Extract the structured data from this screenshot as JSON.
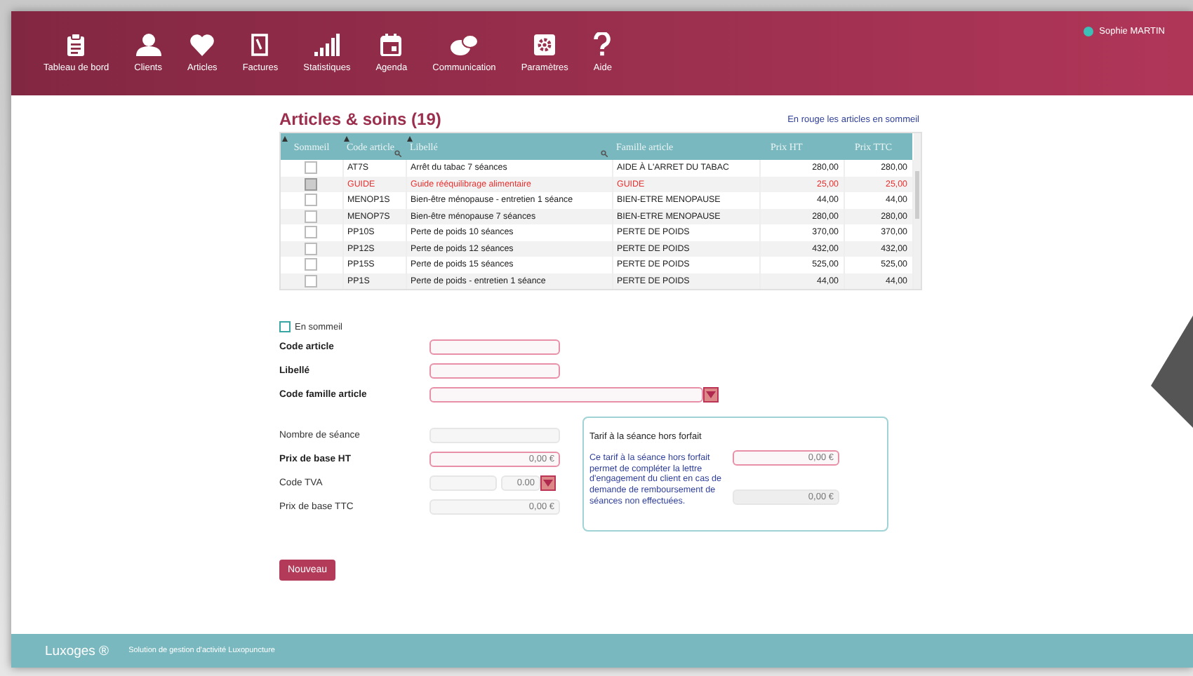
{
  "nav": {
    "items": [
      {
        "label": "Tableau de bord"
      },
      {
        "label": "Clients"
      },
      {
        "label": "Articles"
      },
      {
        "label": "Factures"
      },
      {
        "label": "Statistiques"
      },
      {
        "label": "Agenda"
      },
      {
        "label": "Communication"
      },
      {
        "label": "Paramètres"
      },
      {
        "label": "Aide"
      }
    ],
    "user": {
      "name": "Sophie MARTIN",
      "color": "#3bbfb7"
    }
  },
  "title": "Articles & soins (19)",
  "legend_link": "En rouge les articles en sommeil",
  "table": {
    "columns": [
      {
        "label": "Sommeil",
        "sortable": true,
        "filter": false
      },
      {
        "label": "Code article",
        "sortable": true,
        "filter": true
      },
      {
        "label": "Libellé",
        "sortable": true,
        "filter": true
      },
      {
        "label": "Famille article",
        "sortable": false,
        "filter": false
      },
      {
        "label": "Prix HT",
        "sortable": false,
        "filter": false
      },
      {
        "label": "Prix TTC",
        "sortable": false,
        "filter": false
      }
    ],
    "rows": [
      {
        "sommeil": false,
        "code": "AT7S",
        "libelle": "Arrêt du tabac 7 séances",
        "famille": "AIDE À L'ARRET DU TABAC",
        "prix_ht": "280,00",
        "prix_ttc": "280,00"
      },
      {
        "sommeil": true,
        "code": "GUIDE",
        "libelle": "Guide rééquilibrage alimentaire",
        "famille": "GUIDE",
        "prix_ht": "25,00",
        "prix_ttc": "25,00"
      },
      {
        "sommeil": false,
        "code": "MENOP1S",
        "libelle": "Bien-être ménopause - entretien 1 séance",
        "famille": "BIEN-ETRE MENOPAUSE",
        "prix_ht": "44,00",
        "prix_ttc": "44,00"
      },
      {
        "sommeil": false,
        "code": "MENOP7S",
        "libelle": "Bien-être ménopause 7 séances",
        "famille": "BIEN-ETRE MENOPAUSE",
        "prix_ht": "280,00",
        "prix_ttc": "280,00"
      },
      {
        "sommeil": false,
        "code": "PP10S",
        "libelle": "Perte de poids 10 séances",
        "famille": "PERTE DE POIDS",
        "prix_ht": "370,00",
        "prix_ttc": "370,00"
      },
      {
        "sommeil": false,
        "code": "PP12S",
        "libelle": "Perte de poids 12 séances",
        "famille": "PERTE DE POIDS",
        "prix_ht": "432,00",
        "prix_ttc": "432,00"
      },
      {
        "sommeil": false,
        "code": "PP15S",
        "libelle": "Perte de poids 15 séances",
        "famille": "PERTE DE POIDS",
        "prix_ht": "525,00",
        "prix_ttc": "525,00"
      },
      {
        "sommeil": false,
        "code": "PP1S",
        "libelle": "Perte de poids - entretien 1 séance",
        "famille": "PERTE DE POIDS",
        "prix_ht": "44,00",
        "prix_ttc": "44,00"
      }
    ]
  },
  "sommeil_checkbox": {
    "label": "En sommeil",
    "checked": false
  },
  "fields_top": [
    {
      "label": "Code article",
      "required": true,
      "kind": "text"
    },
    {
      "label": "Libellé",
      "required": true,
      "kind": "text"
    },
    {
      "label": "Code famille article",
      "required": true,
      "kind": "select"
    }
  ],
  "fields_bottom": [
    {
      "label": "Nombre de séance",
      "required": false,
      "kind": "text"
    },
    {
      "label": "Prix de base HT",
      "required": true,
      "kind": "text",
      "value": "0,00 €"
    },
    {
      "label": "Code TVA",
      "required": false,
      "kind": "tva",
      "value": "0.00"
    },
    {
      "label": "Prix de base TTC",
      "required": false,
      "kind": "text",
      "value": "0,00 €"
    }
  ],
  "tarif_panel": {
    "title": "Tarif à la séance hors forfait",
    "value": "0,00 €",
    "value_ttc": "0,00 €",
    "note": "Ce tarif à la séance hors forfait permet de compléter la lettre d'engagement du client en cas de demande de remboursement de séances non effectuées."
  },
  "new_button": "Nouveau",
  "footer": {
    "brand": "Luxoges ®",
    "tagline": "Solution de gestion d'activité Luxopuncture"
  }
}
